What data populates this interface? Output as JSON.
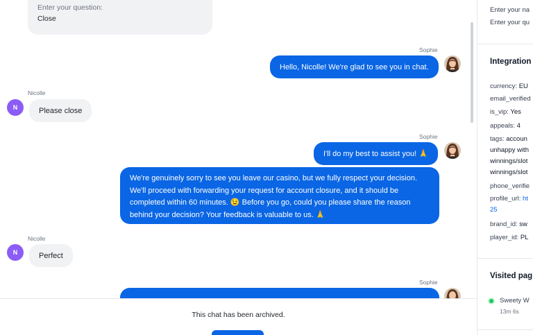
{
  "chat": {
    "prompt_card": {
      "label": "Enter your question:",
      "value": "Close"
    },
    "messages": [
      {
        "author": "Sophie",
        "text": "Hello, Nicolle! We're glad to see you in chat."
      },
      {
        "author": "Nicolle",
        "avatar": "N",
        "text": "Please close"
      },
      {
        "author": "Sophie",
        "text": "I'll do my best to assist you! 🙏"
      },
      {
        "text": "We're genuinely sorry to see you leave our casino, but we fully respect your decision. We'll proceed with forwarding your request for account closure, and it should be completed within 60 minutes. 😉 Before you go, could you please share the reason behind your decision? Your feedback is valuable to us. 🙏"
      },
      {
        "author": "Nicolle",
        "avatar": "N",
        "text": "Perfect"
      },
      {
        "author": "Sophie",
        "text": ""
      }
    ],
    "archived_text": "This chat has been archived."
  },
  "panel": {
    "form_lines": [
      "Enter your na",
      "Enter your qu"
    ],
    "integration_title": "Integration",
    "fields": [
      {
        "key": "currency:",
        "value": "EU"
      },
      {
        "key": "email_verified",
        "value": ""
      },
      {
        "key": "is_vip:",
        "value": "Yes"
      },
      {
        "key": "appeals:",
        "value": "4"
      },
      {
        "key": "tags:",
        "value": "accoun"
      },
      {
        "key": "",
        "value": "unhappy with"
      },
      {
        "key": "",
        "value": "winnings/slot"
      },
      {
        "key": "",
        "value": "winnings/slot"
      },
      {
        "key": "phone_verifie",
        "value": ""
      },
      {
        "key": "profile_url:",
        "value": "ht"
      },
      {
        "key": "",
        "value": "25"
      },
      {
        "key": "brand_id:",
        "value": "sw"
      },
      {
        "key": "player_id:",
        "value": "PL"
      }
    ],
    "visited_title": "Visited pag",
    "visited": [
      {
        "title": "Sweety W",
        "duration": "13m 6s"
      }
    ]
  },
  "colors": {
    "accent": "#0a66e4",
    "avatar_n": "#8b5cf6",
    "status_dot": "#22c55e"
  }
}
